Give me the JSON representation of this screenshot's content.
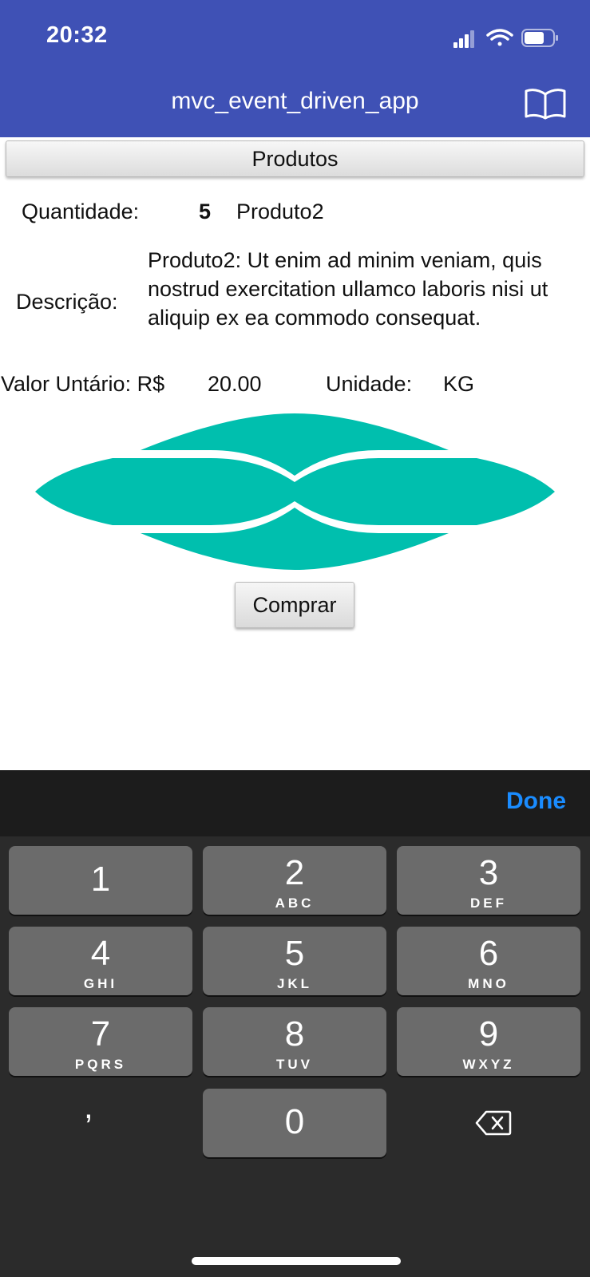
{
  "status_bar": {
    "time": "20:32"
  },
  "app_bar": {
    "title": "mvc_event_driven_app",
    "icon": "book-icon"
  },
  "section": {
    "title": "Produtos"
  },
  "product": {
    "quantity_label": "Quantidade:",
    "quantity_value": "5",
    "name": "Produto2",
    "description_label": "Descrição:",
    "description": "Produto2: Ut enim ad minim veniam, quis nostrud exercitation ullamco laboris nisi ut aliquip ex ea commodo consequat.",
    "price_label": "Valor Untário: R$",
    "price_value": "20.00",
    "unit_label": "Unidade:",
    "unit_value": "KG",
    "image_color": "#00bfae"
  },
  "actions": {
    "buy_label": "Comprar"
  },
  "keyboard": {
    "done_label": "Done",
    "keys": [
      {
        "num": "1",
        "letters": ""
      },
      {
        "num": "2",
        "letters": "ABC"
      },
      {
        "num": "3",
        "letters": "DEF"
      },
      {
        "num": "4",
        "letters": "GHI"
      },
      {
        "num": "5",
        "letters": "JKL"
      },
      {
        "num": "6",
        "letters": "MNO"
      },
      {
        "num": "7",
        "letters": "PQRS"
      },
      {
        "num": "8",
        "letters": "TUV"
      },
      {
        "num": "9",
        "letters": "WXYZ"
      },
      {
        "num": "0",
        "letters": ""
      }
    ],
    "comma": ",",
    "delete_icon": "backspace-icon"
  },
  "colors": {
    "app_bar": "#3f51b5",
    "accent": "#00bfae",
    "done": "#1a8cff",
    "keyboard_bg": "#2b2b2b",
    "key_bg": "#6b6b6b"
  }
}
